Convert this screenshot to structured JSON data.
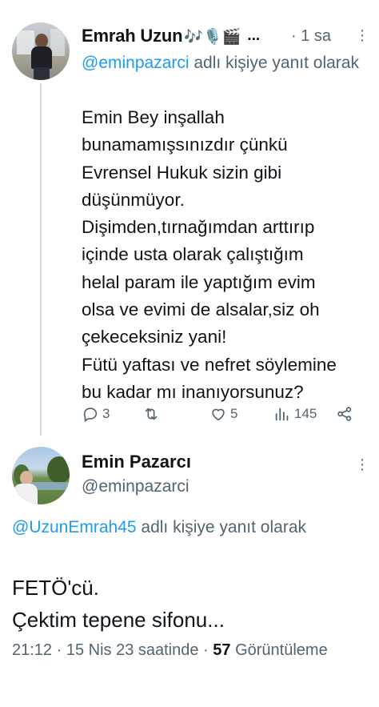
{
  "reply_tweet": {
    "author_name": "Emrah Uzun",
    "author_emojis": "🎶🎙️🎬",
    "name_truncation": "...",
    "time_ago": "· 1 sa",
    "reply_to_handle": "@eminpazarci",
    "reply_to_suffix": " adlı kişiye yanıt olarak",
    "body": "Emin Bey inşallah\nbunamamışsınızdır çünkü\nEvrensel Hukuk sizin gibi\ndüşünmüyor.\nDişimden,tırnağımdan arttırıp\niçinde usta olarak çalıştığım\nhelal param ile yaptığım evim\nolsa ve evimi de alsalar,siz oh\nçekeceksiniz yani!\nFütü yaftası ve nefret söylemine\nbu kadar mı inanıyorsunuz?",
    "actions": {
      "reply_count": "3",
      "retweet_count": "",
      "like_count": "5",
      "view_count": "145"
    }
  },
  "main_tweet": {
    "author_name": "Emin Pazarcı",
    "author_handle": "@eminpazarci",
    "reply_to_handle": "@UzunEmrah45",
    "reply_to_suffix": " adlı kişiye yanıt olarak",
    "body": "FETÖ'cü.\nÇektim tepene sifonu...",
    "timestamp": "21:12 · 15 Nis 23 saatinde · ",
    "view_count": "57",
    "view_label": "Görüntüleme"
  },
  "icons": {
    "reply": "reply-icon",
    "retweet": "retweet-icon",
    "like": "like-icon",
    "views": "views-icon",
    "share": "share-icon",
    "more": "more-icon"
  },
  "colors": {
    "text": "#0f1419",
    "secondary": "#536471",
    "link": "#1d9bf0",
    "thread_line": "#cfd9de"
  }
}
